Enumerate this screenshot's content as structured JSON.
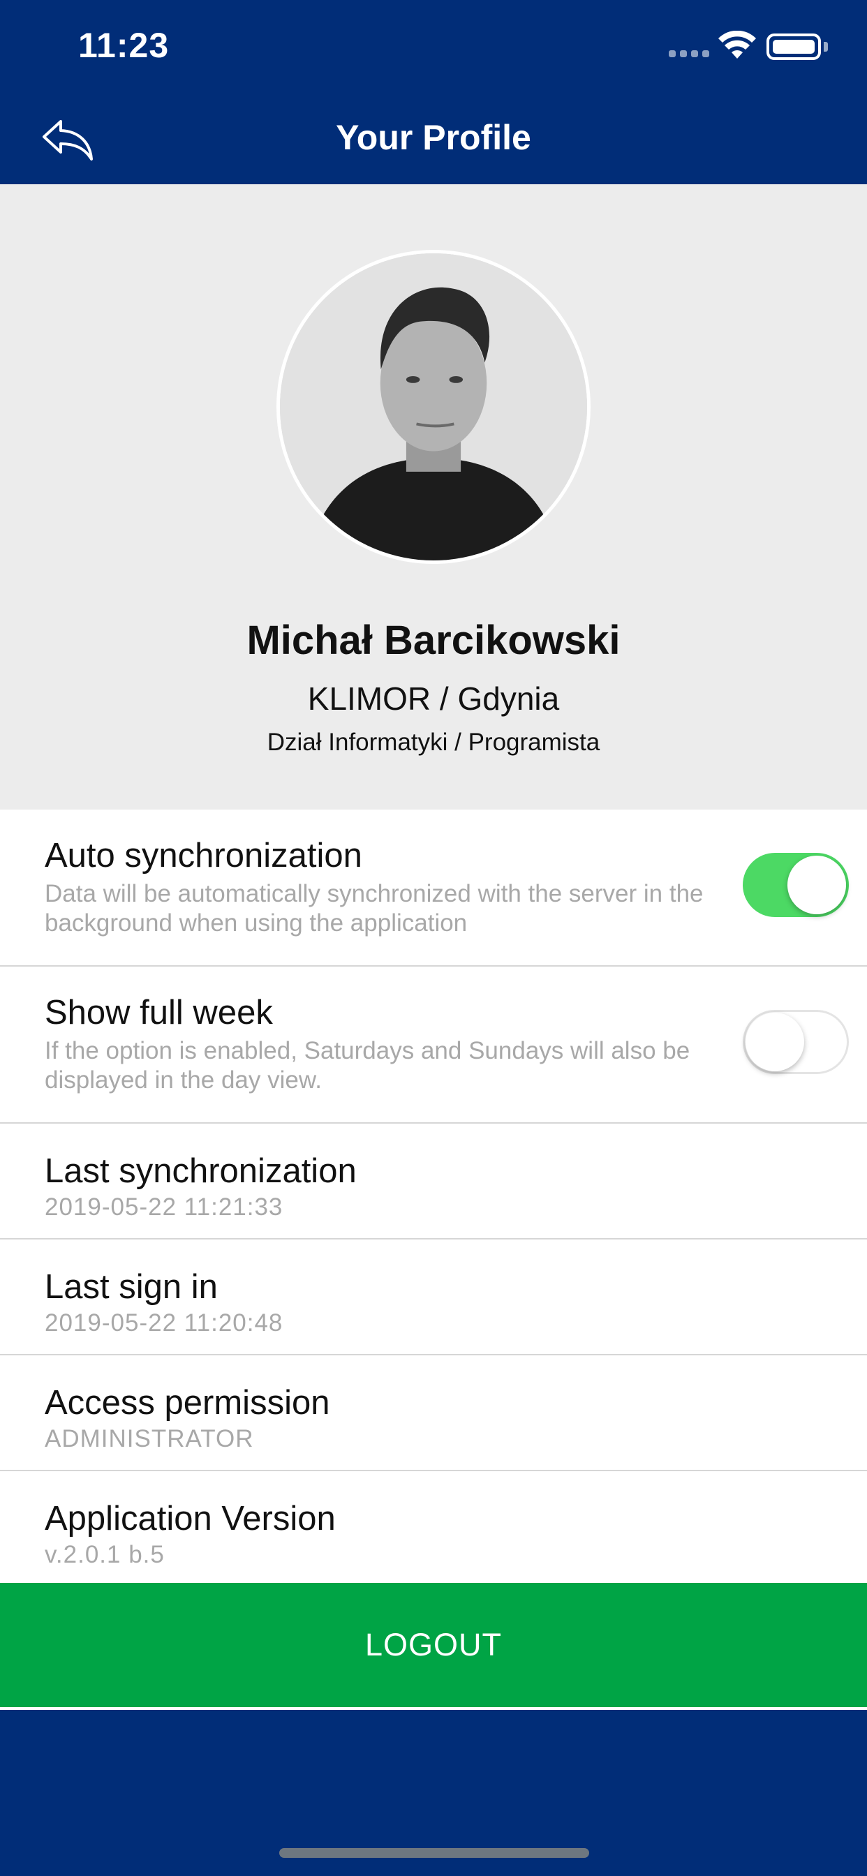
{
  "status_bar": {
    "time": "11:23"
  },
  "nav": {
    "title": "Your Profile",
    "back_icon": "reply-arrow-icon"
  },
  "profile": {
    "name": "Michał Barcikowski",
    "company": "KLIMOR / Gdynia",
    "department": "Dział Informatyki / Programista"
  },
  "settings": {
    "auto_sync": {
      "title": "Auto synchronization",
      "description": "Data will be automatically synchronized with the server in the background when using the application",
      "enabled": true
    },
    "full_week": {
      "title": "Show full week",
      "description": "If the option is enabled, Saturdays and Sundays will also be displayed in the day view.",
      "enabled": false
    },
    "last_sync": {
      "title": "Last synchronization",
      "value": "2019-05-22 11:21:33"
    },
    "last_sign_in": {
      "title": "Last sign in",
      "value": "2019-05-22 11:20:48"
    },
    "access": {
      "title": "Access permission",
      "value": "ADMINISTRATOR"
    },
    "version": {
      "title": "Application Version",
      "value": "v.2.0.1 b.5"
    }
  },
  "logout": {
    "label": "LOGOUT"
  },
  "colors": {
    "header_bg": "#012d78",
    "profile_bg": "#ececec",
    "toggle_on": "#4cd964",
    "logout_bg": "#00a445"
  }
}
